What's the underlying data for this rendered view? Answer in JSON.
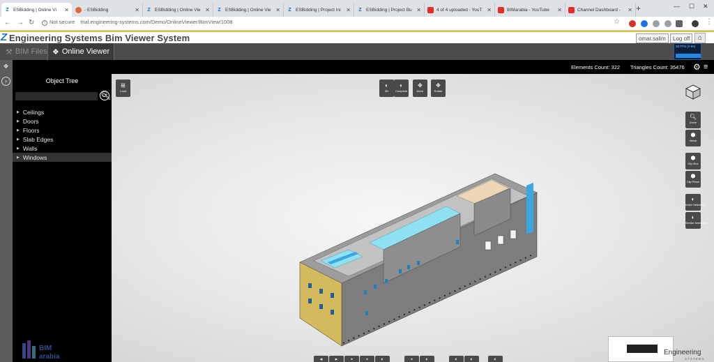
{
  "browser": {
    "tabs": [
      {
        "title": "ESBidding | Online Vi",
        "icon": "z-logo-icon",
        "active": true
      },
      {
        "title": "- ESBidding",
        "icon": "esbidding-icon",
        "active": false
      },
      {
        "title": "ESBidding | Online Vie",
        "icon": "z-logo-icon",
        "active": false
      },
      {
        "title": "ESBidding | Online Vie",
        "icon": "z-logo-icon",
        "active": false
      },
      {
        "title": "ESBidding | Project Ini",
        "icon": "z-logo-icon",
        "active": false
      },
      {
        "title": "ESBidding | Project Bu",
        "icon": "z-logo-icon",
        "active": false
      },
      {
        "title": "4 of 4 uploaded - YouT",
        "icon": "youtube-icon",
        "active": false
      },
      {
        "title": "BIMarabia - YouTube",
        "icon": "youtube-icon",
        "active": false
      },
      {
        "title": "Channel Dashboard -",
        "icon": "youtube-icon",
        "active": false
      }
    ],
    "security_label": "Not secure",
    "url": "trial.engineering-systems.com/Demo/OnlineViewer/BimView/1008"
  },
  "app": {
    "logo_letter": "Z",
    "title": "Engineering Systems Bim Viewer System",
    "user": "omar.salim",
    "logout": "Log off"
  },
  "modules": {
    "bim_files": "BIM Files",
    "online_viewer": "Online Viewer"
  },
  "fps": "38 FPS (0-60)",
  "status": {
    "elements": "Elements Count: 322",
    "triangles": "Triangles Count: 35476"
  },
  "tree": {
    "title": "Object Tree",
    "items": [
      {
        "label": "Ceilings",
        "selected": false
      },
      {
        "label": "Doors",
        "selected": false
      },
      {
        "label": "Floors",
        "selected": false
      },
      {
        "label": "Slab Edges",
        "selected": false
      },
      {
        "label": "Walls",
        "selected": false
      },
      {
        "label": "Windows",
        "selected": true
      }
    ]
  },
  "toolbar": {
    "load": "Load",
    "top": [
      {
        "label": "3D",
        "icon": "half-circle-icon"
      },
      {
        "label": "Complete",
        "icon": "half-circle-icon"
      },
      {
        "label": "Move",
        "icon": "move-icon"
      },
      {
        "label": "Rotate",
        "icon": "rotate-icon"
      }
    ],
    "right": [
      {
        "label": "Zoom",
        "icon": "zoom-icon"
      },
      {
        "label": "Views",
        "icon": "views-icon"
      },
      {
        "label": "Clip Box",
        "icon": "clip-box-icon"
      },
      {
        "label": "Clip Plane",
        "icon": "clip-plane-icon"
      },
      {
        "label": "Invert Selection",
        "icon": "invert-icon"
      },
      {
        "label": "Similar Selection",
        "icon": "similar-icon"
      }
    ]
  },
  "brand": {
    "name": "Engineering",
    "sub": "SYSTEMS"
  },
  "colors": {
    "accent_blue": "#1e73be",
    "header_line": "#d9c23a",
    "model_cyan": "#8fe0f0",
    "model_facade": "#d4ba5c"
  }
}
